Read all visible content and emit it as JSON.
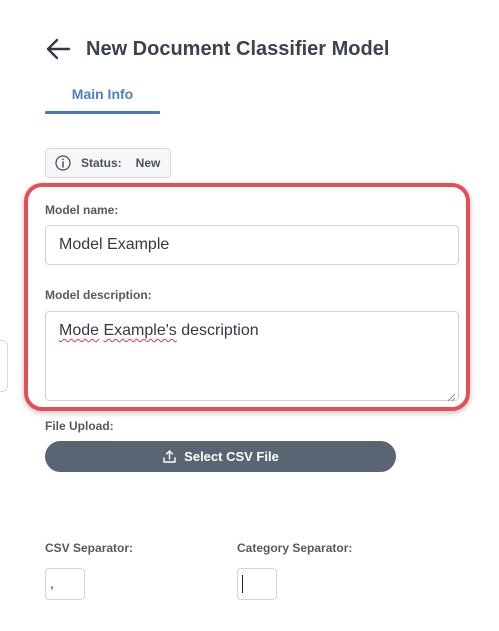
{
  "header": {
    "title": "New Document Classifier Model",
    "back_icon": "arrow-left-icon"
  },
  "tabs": [
    {
      "label": "Main Info",
      "active": true
    }
  ],
  "status": {
    "label": "Status:",
    "value": "New",
    "icon": "info-circle-icon"
  },
  "form": {
    "model_name_label": "Model name:",
    "model_name_value": "Model Example",
    "model_description_label": "Model description:",
    "model_description_value_prefix": "Mode",
    "model_description_value_misspelled": "Example's",
    "model_description_value_suffix": "description",
    "file_upload_label": "File Upload:",
    "select_csv_label": "Select CSV File",
    "csv_separator_label": "CSV Separator:",
    "csv_separator_value": ",",
    "category_separator_label": "Category Separator:",
    "category_separator_value": ""
  },
  "colors": {
    "accent": "#4a78b6",
    "highlight": "#e74d53",
    "button": "#5a6573"
  }
}
